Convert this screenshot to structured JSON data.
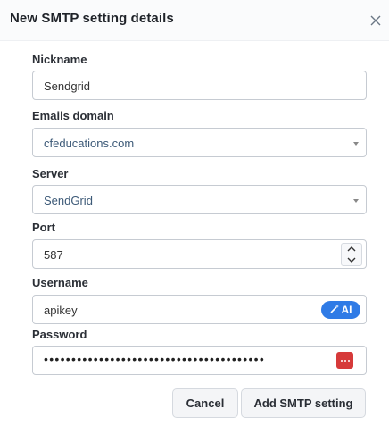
{
  "dialog": {
    "title": "New SMTP setting details"
  },
  "fields": {
    "nickname": {
      "label": "Nickname",
      "value": "Sendgrid"
    },
    "emails_domain": {
      "label": "Emails domain",
      "value": "cfeducations.com"
    },
    "server": {
      "label": "Server",
      "value": "SendGrid"
    },
    "port": {
      "label": "Port",
      "value": "587"
    },
    "username": {
      "label": "Username",
      "value": "apikey",
      "ai_label": "AI"
    },
    "password": {
      "label": "Password",
      "value": "••••••••••••••••••••••••••••••••••••••••"
    }
  },
  "buttons": {
    "cancel": "Cancel",
    "submit": "Add SMTP setting"
  },
  "colors": {
    "accent": "#2f7be6",
    "password_icon": "#d63a3a"
  },
  "icons": {
    "close": "close-icon",
    "ai": "magic-wand-icon",
    "password_manager": "password-manager-icon"
  }
}
